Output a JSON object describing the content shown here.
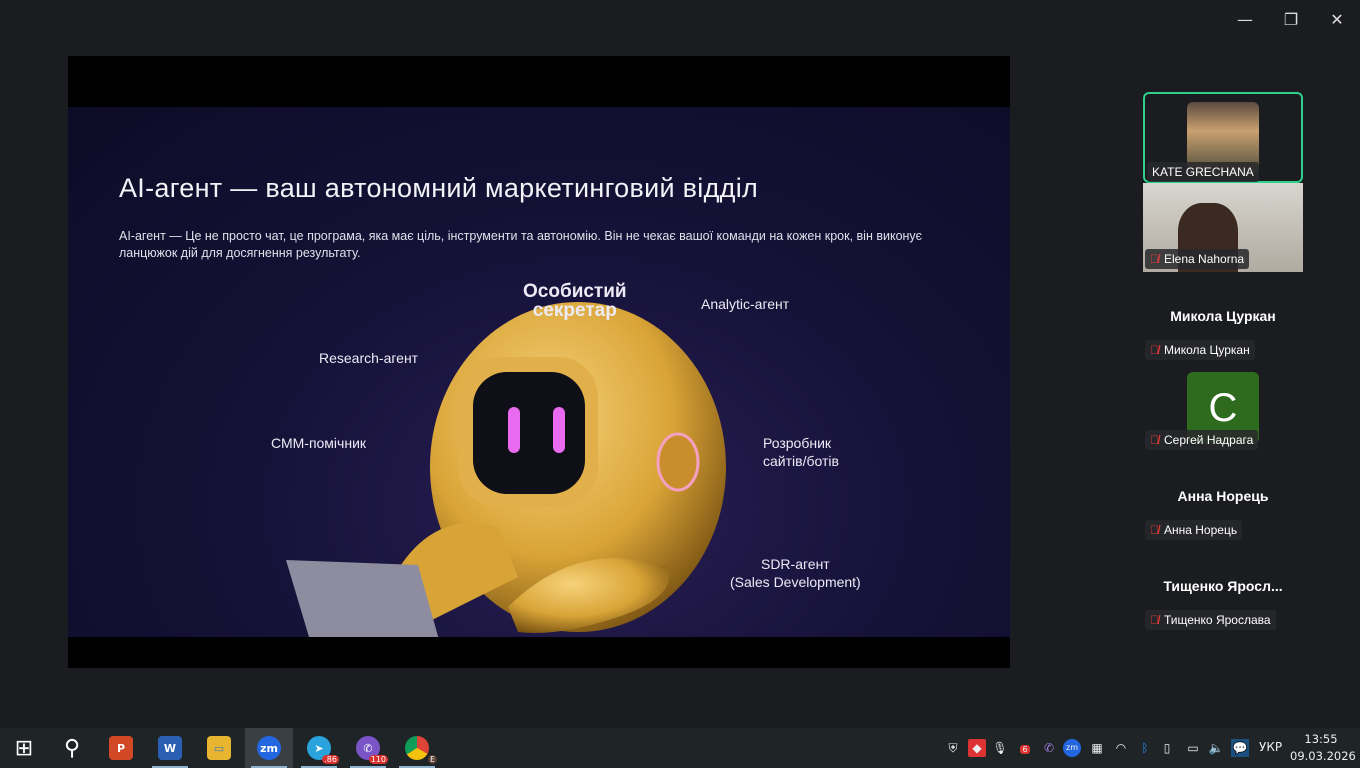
{
  "window": {
    "minimize": "—",
    "restore": "❐",
    "close": "✕"
  },
  "slide": {
    "title": "AI-агент — ваш автономний маркетинговий відділ",
    "description": "AI-агент — Це не просто чат, це програма, яка має ціль, інструменти та автономію. Він не чекає вашої команди на кожен крок, він виконує ланцюжок дій для досягнення результату.",
    "labels": {
      "secretary_1": "Особистий",
      "secretary_2": "секретар",
      "analytic": "Analytic-агент",
      "research": "Research-агент",
      "smm": "СММ-помічник",
      "dev_1": "Розробник",
      "dev_2": "сайтів/ботів",
      "sdr_1": "SDR-агент",
      "sdr_2": "(Sales Development)"
    }
  },
  "participants": [
    {
      "name": "KATE GRECHANA",
      "muted": false,
      "active_speaker": true
    },
    {
      "name": "Elena Nahorna",
      "muted": true
    },
    {
      "display": "Микола Цуркан",
      "name": "Микола Цуркан",
      "muted": true
    },
    {
      "avatar_letter": "C",
      "name": "Сергей Надрага",
      "muted": true,
      "avatar_color": "#2e6b1e"
    },
    {
      "display": "Анна Норець",
      "name": "Анна Норець",
      "muted": true
    },
    {
      "display": "Тищенко  Яросл...",
      "name": "Тищенко Ярослава",
      "muted": true
    }
  ],
  "taskbar": {
    "apps": [
      {
        "name": "start",
        "glyph": "⊞"
      },
      {
        "name": "search",
        "glyph": "⚲"
      },
      {
        "name": "powerpoint",
        "glyph": "P"
      },
      {
        "name": "word",
        "glyph": "W"
      },
      {
        "name": "file-explorer",
        "glyph": "▭"
      },
      {
        "name": "zoom",
        "glyph": "zm"
      },
      {
        "name": "telegram",
        "glyph": "➤",
        "badge": ".86"
      },
      {
        "name": "viber",
        "glyph": "✆",
        "badge": "110"
      },
      {
        "name": "chrome",
        "glyph": "E"
      }
    ],
    "tray_zoom": "zm",
    "language": "УКР",
    "time": "13:55",
    "date": "09.03.2026",
    "tray_badge": "6"
  }
}
